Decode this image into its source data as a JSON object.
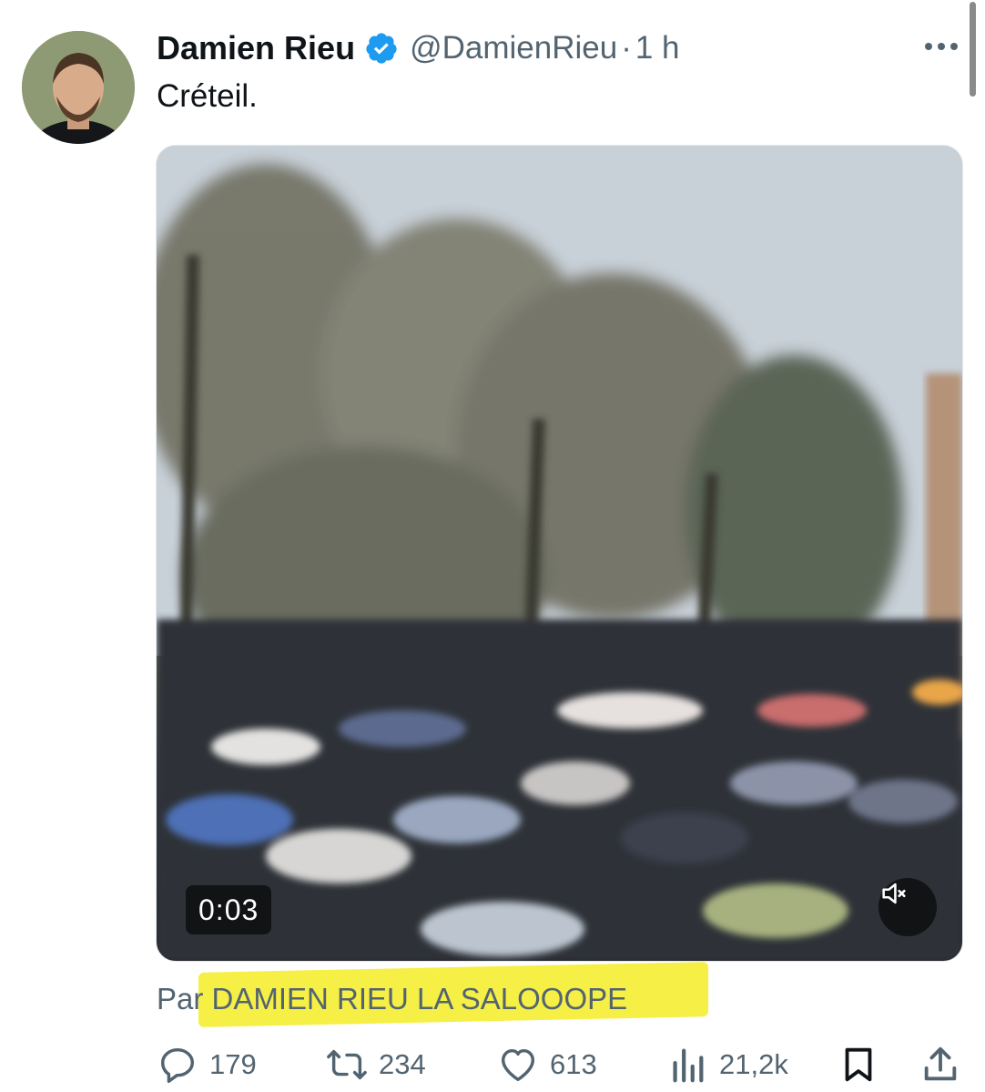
{
  "tweet": {
    "author_name": "Damien Rieu",
    "handle": "@DamienRieu",
    "separator": "·",
    "time": "1 h",
    "text": "Créteil.",
    "video": {
      "timestamp": "0:03"
    },
    "attribution_prefix": "Par",
    "attribution_source": "DAMIEN RIEU LA SALOOOPE",
    "highlight_color": "#f6ee3b"
  },
  "actions": {
    "replies": "179",
    "reposts": "234",
    "likes": "613",
    "views": "21,2k"
  },
  "icons": {
    "verified": "verified-badge-icon",
    "more": "more-icon",
    "mute": "volume-muted-icon",
    "reply": "reply-icon",
    "repost": "repost-icon",
    "like": "heart-icon",
    "views": "views-icon",
    "bookmark": "bookmark-icon",
    "share": "share-icon"
  },
  "colors": {
    "verified": "#1d9bf0",
    "secondary_text": "#536471",
    "primary_text": "#0f1419"
  }
}
